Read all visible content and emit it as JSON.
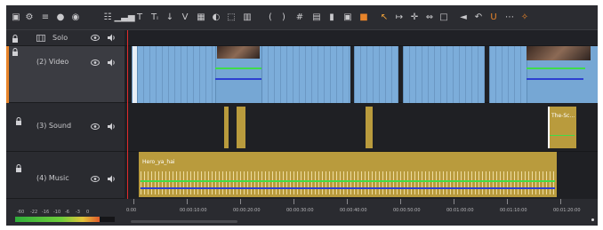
{
  "colors": {
    "accent_orange": "#e8842a",
    "video_clip": "#76a7d4",
    "audio_clip": "#b99b3d",
    "playhead": "#e02b2b",
    "volume_line": "#3fdc4a",
    "pan_line": "#2d3fd1"
  },
  "toolbar": {
    "icons": [
      "display-icon",
      "settings-icon",
      "snap-icon",
      "record-icon",
      "media-icon",
      "mixer-icon",
      "audio-levels-icon",
      "title-icon",
      "subtitle-icon",
      "marker-icon",
      "motion-icon",
      "storyboard-icon",
      "color-icon",
      "crop-icon",
      "stabilize-icon",
      "split-left-icon",
      "split-right-icon",
      "razor-icon",
      "group-icon",
      "link-icon",
      "delete-icon",
      "mark-color-icon",
      "select-tool-icon",
      "trim-tool-icon",
      "move-tool-icon",
      "slip-tool-icon",
      "fit-icon",
      "zoom-out-icon",
      "undo-icon",
      "magnet-icon",
      "more-icon",
      "magic-icon"
    ]
  },
  "tracks": {
    "solo": {
      "label": "Solo"
    },
    "video": {
      "label": "(2) Video"
    },
    "sound": {
      "label": "(3) Sound"
    },
    "music": {
      "label": "(4) Music"
    }
  },
  "clips": {
    "sound_clip_label": "The-Sc...",
    "music_clip_label": "Hero_ya_hai"
  },
  "vu_meter": {
    "scale": [
      "-60",
      "-22",
      "-16",
      "-10",
      "-6",
      "-3",
      "0"
    ],
    "level": 0.85
  },
  "ruler": {
    "ticks": [
      "0:00",
      "00:00:10:00",
      "00:00:20:00",
      "00:00:30:00",
      "00:00:40:00",
      "00:00:50:00",
      "00:01:00:00",
      "00:01:10:00",
      "00:01:20:00"
    ]
  }
}
